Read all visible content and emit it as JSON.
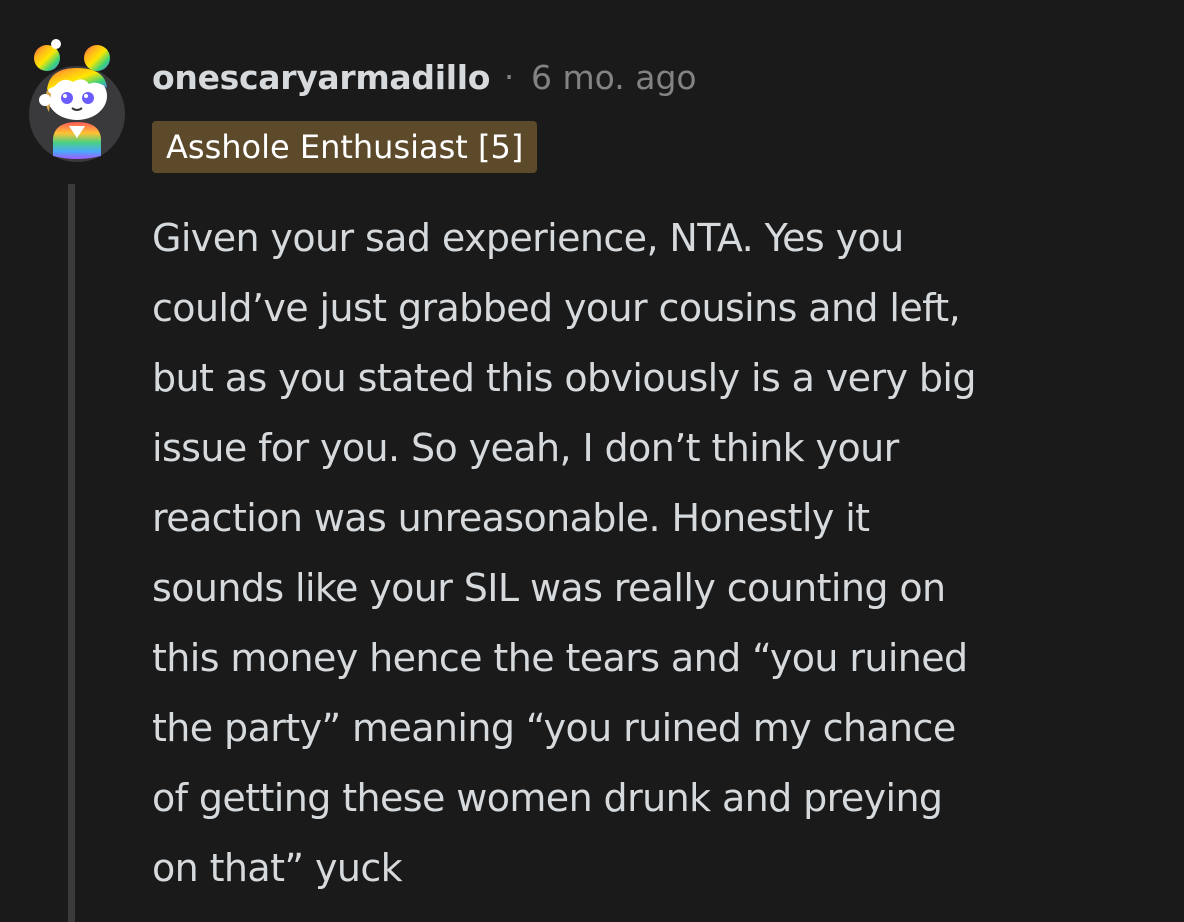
{
  "comment": {
    "author": "onescaryarmadillo",
    "separator": "·",
    "timestamp": "6 mo. ago",
    "flair": {
      "text": "Asshole Enthusiast [5]",
      "background_color": "#5c4a2a"
    },
    "avatar_icon": "snoo-avatar-rainbow-hair",
    "body_lines": [
      "Given your sad experience, NTA. Yes you",
      "could’ve just grabbed your cousins and left,",
      "but as you stated this obviously is a very big",
      "issue for you. So yeah, I don’t think your",
      "reaction was unreasonable. Honestly it",
      "sounds like your SIL was really counting on",
      "this money hence the tears and “you ruined",
      "the party” meaning “you ruined my chance",
      "of getting these women drunk and preying",
      "on that” yuck"
    ]
  },
  "colors": {
    "background": "#1a1a1b",
    "text": "#d7dadc",
    "muted_text": "#818384",
    "thread_line": "#3a3a3c"
  }
}
